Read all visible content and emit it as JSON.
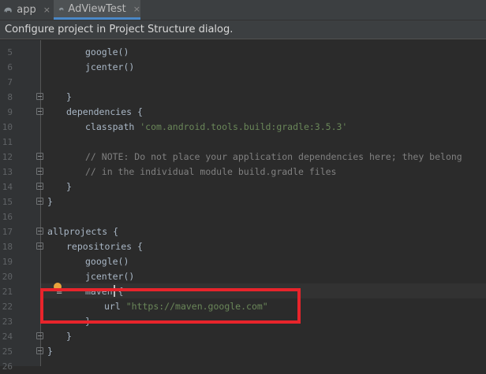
{
  "tabs": [
    {
      "label": "app",
      "close": "×"
    },
    {
      "label": "AdViewTest",
      "close": "×"
    }
  ],
  "notice": "Configure project in Project Structure dialog.",
  "lines": [
    {
      "num": "5",
      "indent": 2,
      "parts": [
        {
          "t": "google()",
          "c": ""
        }
      ]
    },
    {
      "num": "6",
      "indent": 2,
      "parts": [
        {
          "t": "jcenter()",
          "c": ""
        }
      ]
    },
    {
      "num": "7",
      "indent": 0,
      "parts": []
    },
    {
      "num": "8",
      "indent": 1,
      "parts": [
        {
          "t": "}",
          "c": ""
        }
      ]
    },
    {
      "num": "9",
      "indent": 1,
      "parts": [
        {
          "t": "dependencies {",
          "c": ""
        }
      ]
    },
    {
      "num": "10",
      "indent": 2,
      "parts": [
        {
          "t": "classpath ",
          "c": ""
        },
        {
          "t": "'com.android.tools.build:gradle:3.5.3'",
          "c": "str"
        }
      ]
    },
    {
      "num": "11",
      "indent": 0,
      "parts": []
    },
    {
      "num": "12",
      "indent": 2,
      "parts": [
        {
          "t": "// NOTE: Do not place your application dependencies here; they belong",
          "c": "cmt"
        }
      ]
    },
    {
      "num": "13",
      "indent": 2,
      "parts": [
        {
          "t": "// in the individual module build.gradle files",
          "c": "cmt"
        }
      ]
    },
    {
      "num": "14",
      "indent": 1,
      "parts": [
        {
          "t": "}",
          "c": ""
        }
      ]
    },
    {
      "num": "15",
      "indent": 0,
      "parts": [
        {
          "t": "}",
          "c": ""
        }
      ]
    },
    {
      "num": "16",
      "indent": 0,
      "parts": []
    },
    {
      "num": "17",
      "indent": 0,
      "parts": [
        {
          "t": "allprojects {",
          "c": ""
        }
      ]
    },
    {
      "num": "18",
      "indent": 1,
      "parts": [
        {
          "t": "repositories {",
          "c": ""
        }
      ]
    },
    {
      "num": "19",
      "indent": 2,
      "parts": [
        {
          "t": "google()",
          "c": ""
        }
      ]
    },
    {
      "num": "20",
      "indent": 2,
      "parts": [
        {
          "t": "jcenter()",
          "c": ""
        }
      ]
    },
    {
      "num": "21",
      "indent": 2,
      "parts": [
        {
          "t": "maven {",
          "c": ""
        }
      ]
    },
    {
      "num": "22",
      "indent": 3,
      "parts": [
        {
          "t": "url ",
          "c": ""
        },
        {
          "t": "\"https://maven.google.com\"",
          "c": "str"
        }
      ]
    },
    {
      "num": "23",
      "indent": 2,
      "parts": [
        {
          "t": "}",
          "c": ""
        }
      ]
    },
    {
      "num": "24",
      "indent": 1,
      "parts": [
        {
          "t": "}",
          "c": ""
        }
      ]
    },
    {
      "num": "25",
      "indent": 0,
      "parts": [
        {
          "t": "}",
          "c": ""
        }
      ]
    },
    {
      "num": "26",
      "indent": 0,
      "parts": []
    }
  ],
  "colors": {
    "highlight_box": "#e8242b",
    "string": "#6a8759",
    "comment": "#808080",
    "code": "#a9b7c6"
  }
}
